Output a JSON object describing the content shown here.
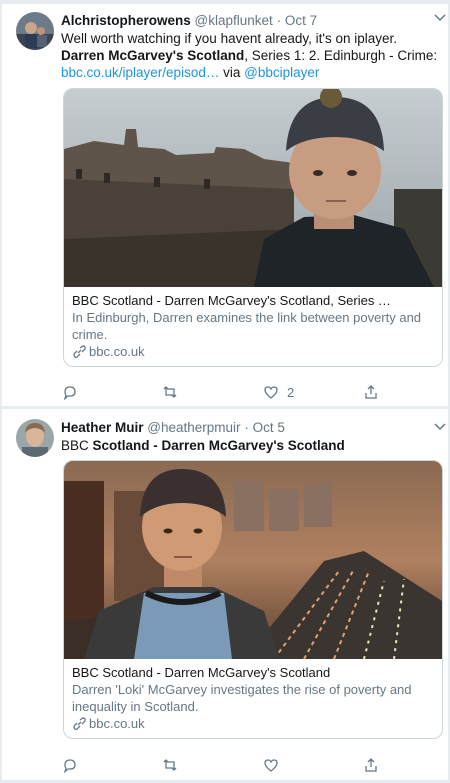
{
  "tweets": [
    {
      "author_name": "Alchristopherowens",
      "handle": "@klapflunket",
      "date": "Oct 7",
      "text_line1": "Well worth watching if you havent already, it's on iplayer.",
      "text_bold": "Darren McGarvey's Scotland",
      "text_mid": ", Series 1: 2. Edinburgh - Crime: ",
      "text_link": "bbc.co.uk/iplayer/episod…",
      "text_via": " via ",
      "text_mention": "@bbciplayer",
      "card": {
        "title": "BBC Scotland - Darren McGarvey's Scotland, Series …",
        "description": "In Edinburgh, Darren examines the link between poverty and crime.",
        "domain": "bbc.co.uk"
      },
      "actions": {
        "reply_count": "",
        "retweet_count": "",
        "like_count": "2"
      }
    },
    {
      "author_name": "Heather Muir",
      "handle": "@heatherpmuir",
      "date": "Oct 5",
      "text_plain": "BBC ",
      "text_bold": "Scotland - Darren McGarvey's Scotland",
      "card": {
        "title": "BBC Scotland - Darren McGarvey's Scotland",
        "description": "Darren 'Loki' McGarvey investigates the rise of poverty and inequality in Scotland.",
        "domain": "bbc.co.uk"
      },
      "actions": {
        "reply_count": "",
        "retweet_count": "",
        "like_count": ""
      }
    }
  ],
  "icons": [
    "chevron-down-icon",
    "reply-icon",
    "retweet-icon",
    "like-icon",
    "share-icon",
    "link-icon"
  ],
  "colors": {
    "link": "#1b95e0",
    "muted": "#657786",
    "border": "#ccd6dd",
    "text": "#14171a"
  }
}
